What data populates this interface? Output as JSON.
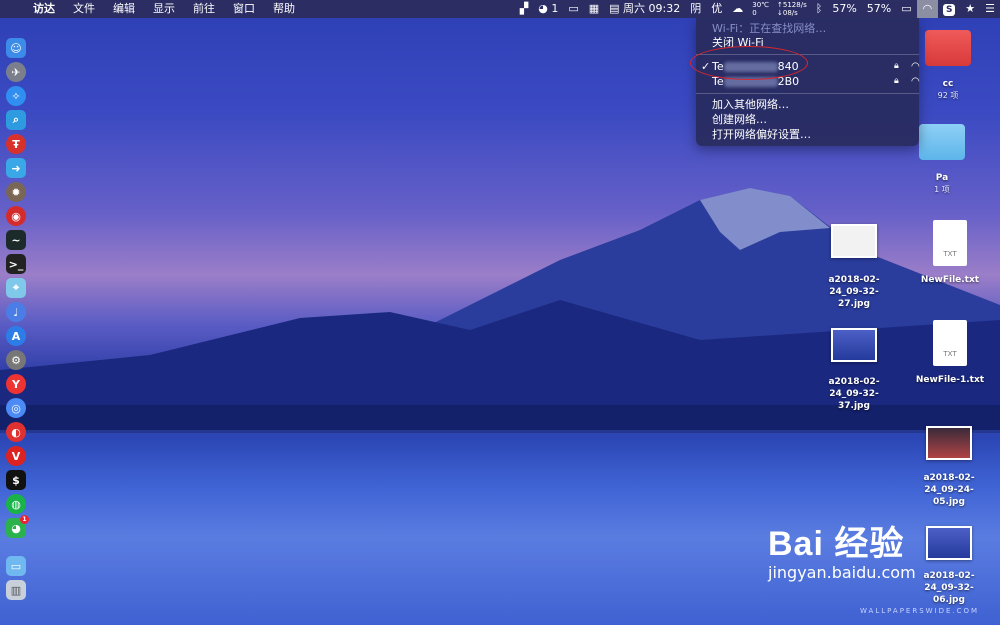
{
  "menubar": {
    "apple_icon": "apple-icon",
    "app_name": "访达",
    "menus": [
      "文件",
      "编辑",
      "显示",
      "前往",
      "窗口",
      "帮助"
    ],
    "status": {
      "wechat_count": "1",
      "clock": "周六 09:32",
      "weather": "阴",
      "aqi": "优",
      "temp": "30℃",
      "temp2": "0",
      "net_up": "↑5128/s",
      "net_down": "↓08/s",
      "cpu": "57%",
      "battery": "57%"
    }
  },
  "wifi_menu": {
    "status_label": "Wi-Fi：正在查找网络…",
    "turn_off_label": "关闭 Wi-Fi",
    "networks": [
      {
        "prefix": "Te",
        "suffix": "840",
        "selected": true
      },
      {
        "prefix": "Te",
        "suffix": "2B0",
        "selected": false
      }
    ],
    "actions": [
      "加入其他网络…",
      "创建网络…",
      "打开网络偏好设置…"
    ]
  },
  "desktop_icons": [
    {
      "name": "cc",
      "sub": "92 项"
    },
    {
      "name": "Pa",
      "sub": "1 项"
    },
    {
      "name": "a2018-02-24_09-32-27.jpg"
    },
    {
      "name": "NewFile.txt",
      "kind": "TXT"
    },
    {
      "name": "a2018-02-24_09-32-37.jpg"
    },
    {
      "name": "NewFile-1.txt",
      "kind": "TXT"
    },
    {
      "name": "a2018-02-24_09-24-05.jpg"
    },
    {
      "name": "a2018-02-24_09-32-06.jpg"
    }
  ],
  "watermark": {
    "brand": "Bai  经验",
    "url": "jingyan.baidu.com",
    "wallpaper": "WALLPAPERSWIDE.COM"
  }
}
